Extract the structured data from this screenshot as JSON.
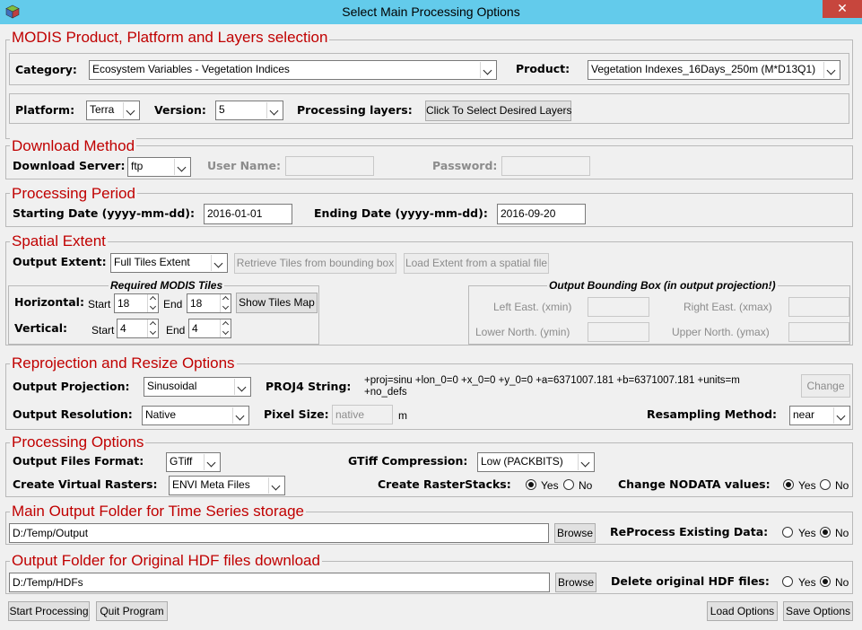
{
  "window": {
    "title": "Select Main Processing Options",
    "close_label": "✕"
  },
  "product_section": {
    "title": "MODIS Product, Platform and Layers selection",
    "category_label": "Category:",
    "category_value": "Ecosystem Variables - Vegetation Indices",
    "product_label": "Product:",
    "product_value": "Vegetation Indexes_16Days_250m (M*D13Q1)",
    "platform_label": "Platform:",
    "platform_value": "Terra",
    "version_label": "Version:",
    "version_value": "5",
    "layers_label": "Processing layers:",
    "layers_button": "Click To Select Desired Layers"
  },
  "download_section": {
    "title": "Download Method",
    "server_label": "Download Server:",
    "server_value": "ftp",
    "user_label": "User Name:",
    "user_value": "",
    "password_label": "Password:",
    "password_value": ""
  },
  "period_section": {
    "title": "Processing Period",
    "start_label": "Starting Date (yyyy-mm-dd):",
    "start_value": "2016-01-01",
    "end_label": "Ending Date (yyyy-mm-dd):",
    "end_value": "2016-09-20"
  },
  "extent_section": {
    "title": "Spatial Extent",
    "output_extent_label": "Output Extent:",
    "output_extent_value": "Full Tiles Extent",
    "retrieve_button": "Retrieve Tiles from bounding box",
    "load_extent_button": "Load Extent from a spatial file",
    "tiles_title": "Required MODIS Tiles",
    "horizontal_label": "Horizontal:",
    "vertical_label": "Vertical:",
    "start_label": "Start",
    "end_label": "End",
    "h_start": "18",
    "h_end": "18",
    "v_start": "4",
    "v_end": "4",
    "show_map_button": "Show Tiles Map",
    "bbox_title": "Output Bounding Box (in output projection!)",
    "left_label": "Left East. (xmin)",
    "right_label": "Right East. (xmax)",
    "lower_label": "Lower North. (ymin)",
    "upper_label": "Upper North. (ymax)"
  },
  "reprojection_section": {
    "title": "Reprojection and Resize Options",
    "projection_label": "Output Projection:",
    "projection_value": "Sinusoidal",
    "proj4_label": "PROJ4 String:",
    "proj4_line1": "+proj=sinu +lon_0=0 +x_0=0 +y_0=0 +a=6371007.181 +b=6371007.181 +units=m",
    "proj4_line2": "+no_defs",
    "change_button": "Change",
    "resolution_label": "Output Resolution:",
    "resolution_value": "Native",
    "pixel_size_label": "Pixel Size:",
    "pixel_size_value": "native",
    "pixel_unit": "m",
    "resampling_label": "Resampling Method:",
    "resampling_value": "near"
  },
  "processing_section": {
    "title": "Processing Options",
    "format_label": "Output Files Format:",
    "format_value": "GTiff",
    "compression_label": "GTiff Compression:",
    "compression_value": "Low (PACKBITS)",
    "virtual_label": "Create Virtual Rasters:",
    "virtual_value": "ENVI Meta Files",
    "rasterstacks_label": "Create RasterStacks:",
    "nodata_label": "Change NODATA values:",
    "yes": "Yes",
    "no": "No"
  },
  "output_section": {
    "title": "Main Output Folder for Time Series storage",
    "path": "D:/Temp/Output",
    "browse": "Browse",
    "reprocess_label": "ReProcess Existing Data:"
  },
  "hdf_section": {
    "title": "Output Folder for Original HDF files download",
    "path": "D:/Temp/HDFs",
    "browse": "Browse",
    "delete_label": "Delete original HDF files:"
  },
  "footer": {
    "start": "Start Processing",
    "quit": "Quit Program",
    "load": "Load Options",
    "save": "Save Options"
  }
}
